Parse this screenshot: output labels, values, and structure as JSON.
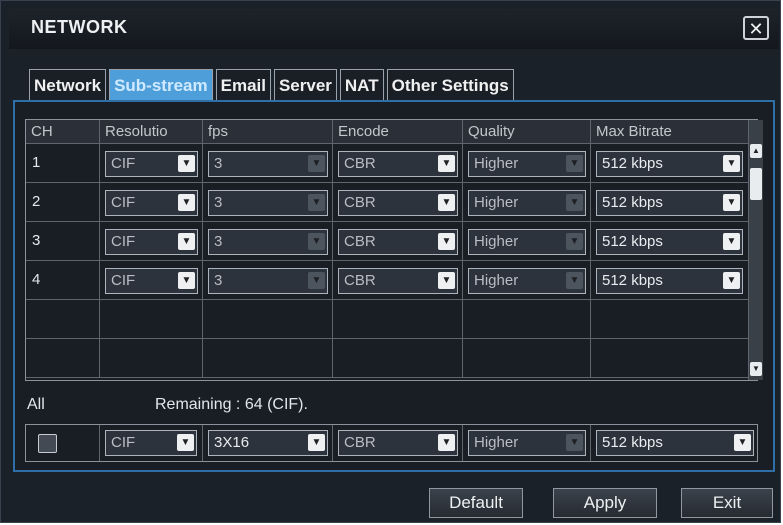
{
  "window": {
    "title": "NETWORK",
    "close_glyph": "✕",
    "close_icon": "close-icon"
  },
  "tabs": [
    {
      "label": "Network",
      "active": false
    },
    {
      "label": "Sub-stream",
      "active": true
    },
    {
      "label": "Email",
      "active": false
    },
    {
      "label": "Server",
      "active": false
    },
    {
      "label": "NAT",
      "active": false
    },
    {
      "label": "Other Settings",
      "active": false
    }
  ],
  "table": {
    "headers": [
      "CH",
      "Resolutio",
      "fps",
      "Encode",
      "Quality",
      "Max Bitrate"
    ],
    "rows": [
      {
        "ch": "1",
        "resolution": "CIF",
        "fps": "3",
        "encode": "CBR",
        "quality": "Higher",
        "max_bitrate": "512 kbps"
      },
      {
        "ch": "2",
        "resolution": "CIF",
        "fps": "3",
        "encode": "CBR",
        "quality": "Higher",
        "max_bitrate": "512 kbps"
      },
      {
        "ch": "3",
        "resolution": "CIF",
        "fps": "3",
        "encode": "CBR",
        "quality": "Higher",
        "max_bitrate": "512 kbps"
      },
      {
        "ch": "4",
        "resolution": "CIF",
        "fps": "3",
        "encode": "CBR",
        "quality": "Higher",
        "max_bitrate": "512 kbps"
      }
    ],
    "empty_rows": 2
  },
  "all": {
    "label": "All",
    "remaining": "Remaining : 64 (CIF).",
    "resolution": "CIF",
    "fps": "3X16",
    "encode": "CBR",
    "quality": "Higher",
    "max_bitrate": "512 kbps"
  },
  "buttons": {
    "default": "Default",
    "apply": "Apply",
    "exit": "Exit"
  },
  "colors": {
    "accent": "#4e9fd9",
    "panel_border": "#2f6fa8",
    "background": "#1b2128"
  },
  "icons": {
    "dropdown": "chevron-down-icon",
    "scroll_up": "scroll-up-icon",
    "scroll_down": "scroll-down-icon"
  }
}
